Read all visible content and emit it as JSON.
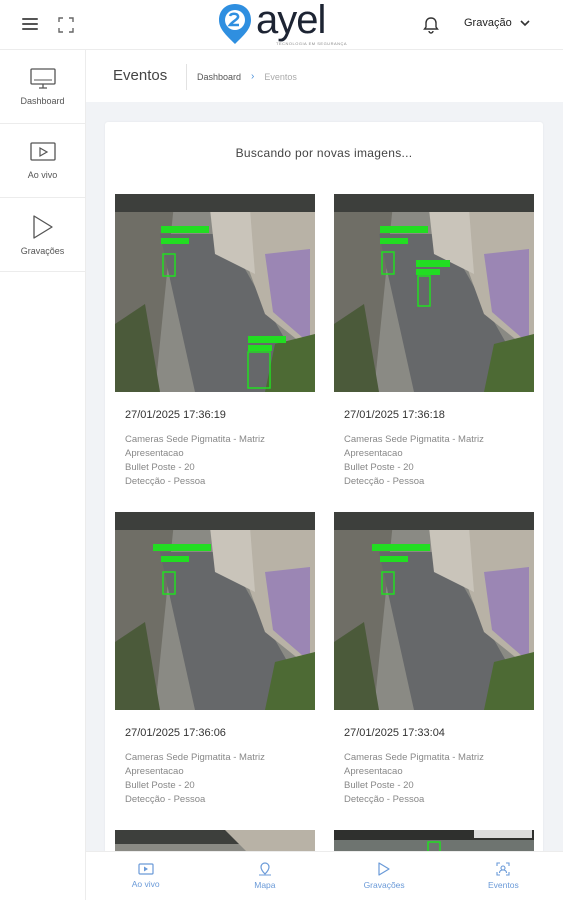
{
  "header": {
    "logo_text": "ayel",
    "logo_subtitle": "TECNOLOGIA EM SEGURANÇA",
    "user_label": "Gravação"
  },
  "sidebar": {
    "items": [
      {
        "label": "Dashboard",
        "icon": "monitor-icon"
      },
      {
        "label": "Ao vivo",
        "icon": "play-square-icon"
      },
      {
        "label": "Gravações",
        "icon": "play-triangle-icon"
      }
    ]
  },
  "page": {
    "title": "Eventos",
    "breadcrumb": [
      "Dashboard",
      "Eventos"
    ]
  },
  "status_text": "Buscando por novas imagens...",
  "events": [
    {
      "time": "27/01/2025 17:36:19",
      "camera": "Cameras Sede Pigmatita - Matriz",
      "group": "Apresentacao",
      "device": "Bullet Poste - 20",
      "detection": "Detecção - Pessoa"
    },
    {
      "time": "27/01/2025 17:36:18",
      "camera": "Cameras Sede Pigmatita - Matriz",
      "group": "Apresentacao",
      "device": "Bullet Poste - 20",
      "detection": "Detecção - Pessoa"
    },
    {
      "time": "27/01/2025 17:36:06",
      "camera": "Cameras Sede Pigmatita - Matriz",
      "group": "Apresentacao",
      "device": "Bullet Poste - 20",
      "detection": "Detecção - Pessoa"
    },
    {
      "time": "27/01/2025 17:33:04",
      "camera": "Cameras Sede Pigmatita - Matriz",
      "group": "Apresentacao",
      "device": "Bullet Poste - 20",
      "detection": "Detecção - Pessoa"
    }
  ],
  "bottom_nav": [
    {
      "label": "Ao vivo",
      "icon": "video-icon"
    },
    {
      "label": "Mapa",
      "icon": "map-pin-icon"
    },
    {
      "label": "Gravações",
      "icon": "play-triangle-icon"
    },
    {
      "label": "Eventos",
      "icon": "target-icon"
    }
  ],
  "colors": {
    "accent": "#6a9ad8",
    "breadcrumb_separator": "#4a90d9",
    "detection_box": "#22dd22",
    "logo_blue": "#2f8fe0"
  }
}
